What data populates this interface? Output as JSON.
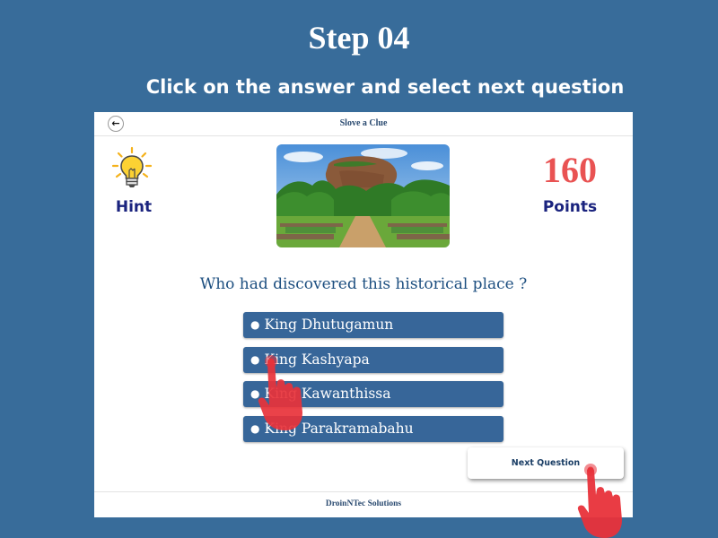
{
  "tutorial": {
    "step": "Step 04",
    "instruction": "Click on the answer and select next question"
  },
  "app": {
    "title": "Slove a Clue",
    "back_icon": "back-arrow-icon",
    "footer": "DroinNTec Solutions"
  },
  "hint": {
    "label": "Hint",
    "icon": "lightbulb-icon"
  },
  "points": {
    "value": "160",
    "label": "Points"
  },
  "question": "Who had discovered this historical place ?",
  "answers": [
    {
      "label": "King Dhutugamun"
    },
    {
      "label": "King Kashyapa"
    },
    {
      "label": "King Kawanthissa"
    },
    {
      "label": "King Parakramabahu"
    }
  ],
  "next_button": "Next Question",
  "colors": {
    "background": "#386c9a",
    "answer_button": "#376699",
    "points": "#e95353",
    "label": "#1a237e",
    "pointer_hand": "#e8323a"
  }
}
